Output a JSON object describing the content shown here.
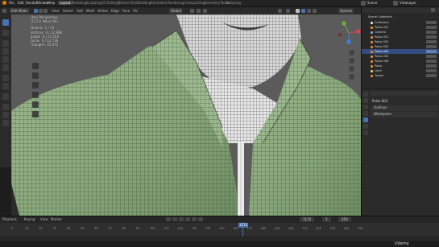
{
  "menu": {
    "items": [
      "File",
      "Edit",
      "Render",
      "Window",
      "Help"
    ],
    "workspaces": [
      "Layout",
      "Modeling",
      "Sculpting",
      "UV Editing",
      "Texture Paint",
      "Shading",
      "Animation",
      "Rendering",
      "Compositing",
      "Geometry Nodes",
      "Scripting"
    ],
    "active_workspace": "Layout",
    "scene": "Scene",
    "view_layer": "ViewLayer"
  },
  "viewport_header": {
    "mode": "Edit Mode",
    "menus": [
      "View",
      "Select",
      "Add",
      "Mesh",
      "Vertex",
      "Edge",
      "Face",
      "UV"
    ],
    "orientation": "Global",
    "options": "Options"
  },
  "overlay": {
    "view": "User Perspective",
    "object": "(1172) Polos 003",
    "stats": [
      {
        "label": "Objects",
        "value": "1 / 10"
      },
      {
        "label": "Vertices",
        "value": "0 / 12,808"
      },
      {
        "label": "Edges",
        "value": "0 / 25,540"
      },
      {
        "label": "Faces",
        "value": "0 / 12,736"
      },
      {
        "label": "Triangles",
        "value": "25,472"
      }
    ]
  },
  "outliner": {
    "title": "Scene Collection",
    "rows": [
      "Collection",
      "Polos.001",
      "Camera",
      "Polos.001",
      "Polos.002",
      "Polos.003",
      "Polos.004",
      "Polos.005",
      "Polos.006",
      "Polos",
      "Light",
      "Target"
    ],
    "selected_index": 6
  },
  "properties": {
    "object_name": "Polos.003",
    "sections": [
      "Outlines",
      "Workspace"
    ]
  },
  "timeline": {
    "menus": [
      "Playback",
      "Keying",
      "View",
      "Marker"
    ],
    "current_frame": "1172",
    "start": "1",
    "end": "250",
    "ticks": [
      "0",
      "10",
      "20",
      "30",
      "40",
      "50",
      "60",
      "70",
      "80",
      "90",
      "100",
      "110",
      "120",
      "130",
      "140",
      "150",
      "160",
      "170",
      "180",
      "190",
      "200",
      "210",
      "220",
      "230",
      "240",
      "250"
    ]
  },
  "brand": {
    "watermark": "Udemy"
  },
  "colors": {
    "accent": "#4772b3",
    "shirt": "#8aa87c",
    "selected_row": "#334d80",
    "x_axis": "#e0404a",
    "y_axis": "#6fb03c",
    "z_axis": "#3f7fe0"
  }
}
